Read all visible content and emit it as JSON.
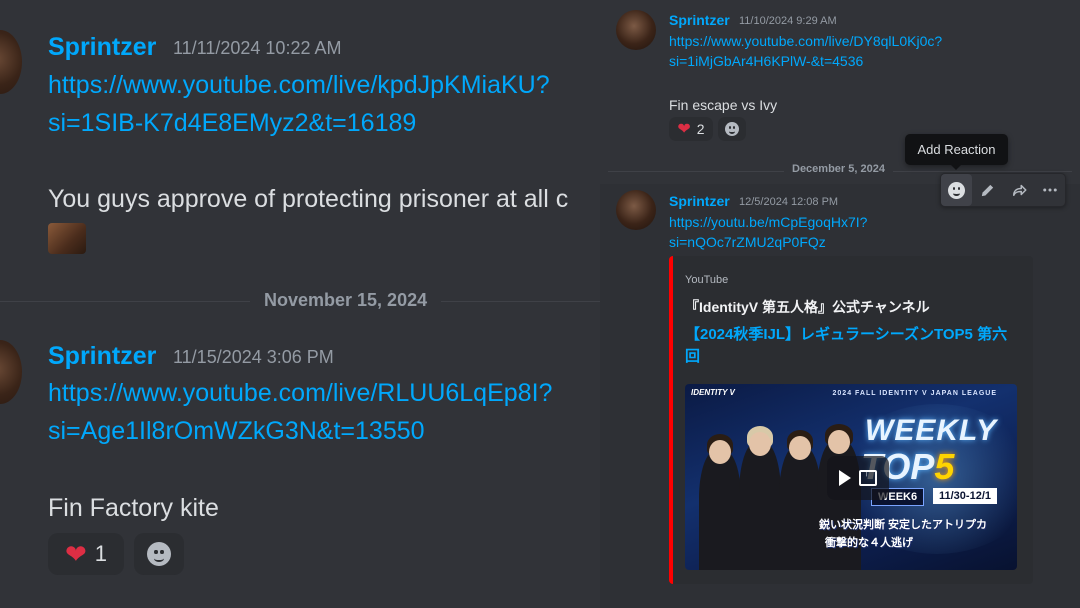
{
  "left": {
    "messages": [
      {
        "username": "Sprintzer",
        "timestamp": "11/11/2024 10:22 AM",
        "link_line1": "https://www.youtube.com/live/kpdJpKMiaKU?",
        "link_line2": "si=1SIB-K7d4E8EMyz2&t=16189",
        "text": "You guys approve of protecting prisoner at all c"
      },
      {
        "username": "Sprintzer",
        "timestamp": "11/15/2024 3:06 PM",
        "link_line1": "https://www.youtube.com/live/RLUU6LqEp8I?",
        "link_line2": "si=Age1Il8rOmWZkG3N&t=13550",
        "text": "Fin Factory kite",
        "reaction": {
          "emoji": "❤",
          "count": "1"
        }
      }
    ],
    "date_divider": "November 15, 2024"
  },
  "right": {
    "messages": [
      {
        "username": "Sprintzer",
        "timestamp": "11/10/2024 9:29 AM",
        "link_line1": "https://www.youtube.com/live/DY8qlL0Kj0c?",
        "link_line2": "si=1iMjGbAr4H6KPlW-&t=4536",
        "text": "Fin escape vs Ivy",
        "reaction": {
          "emoji": "❤",
          "count": "2"
        }
      },
      {
        "username": "Sprintzer",
        "timestamp": "12/5/2024 12:08 PM",
        "link_line1": "https://youtu.be/mCpEgoqHx7I?",
        "link_line2": "si=nQOc7rZMU2qP0FQz"
      }
    ],
    "date_divider": "December 5, 2024",
    "tooltip": "Add Reaction",
    "toolbar": {
      "icons": [
        "add-reaction-icon",
        "edit-pencil-icon",
        "forward-icon",
        "more-icon"
      ]
    },
    "embed": {
      "provider": "YouTube",
      "author": "『IdentityV 第五人格』公式チャンネル",
      "title": "【2024秋季IJL】レギュラーシーズンTOP5 第六回",
      "accent_color": "#ff0000",
      "thumbnail": {
        "logo": "IDENTITY V",
        "league": "2024 FALL IDENTITY V JAPAN LEAGUE",
        "weekly": "WEEKLY",
        "top": "TOP",
        "five": "5",
        "week": "WEEK6",
        "dates": "11/30-12/1",
        "caption1": "鋭い状況判断 安定したアトリプカ",
        "caption2": "衝撃的な４人逃げ"
      }
    }
  },
  "colors": {
    "background": "#313338",
    "username": "#00a8fc",
    "link": "#00a8fc",
    "text": "#dbdee1",
    "muted": "#949ba4"
  }
}
